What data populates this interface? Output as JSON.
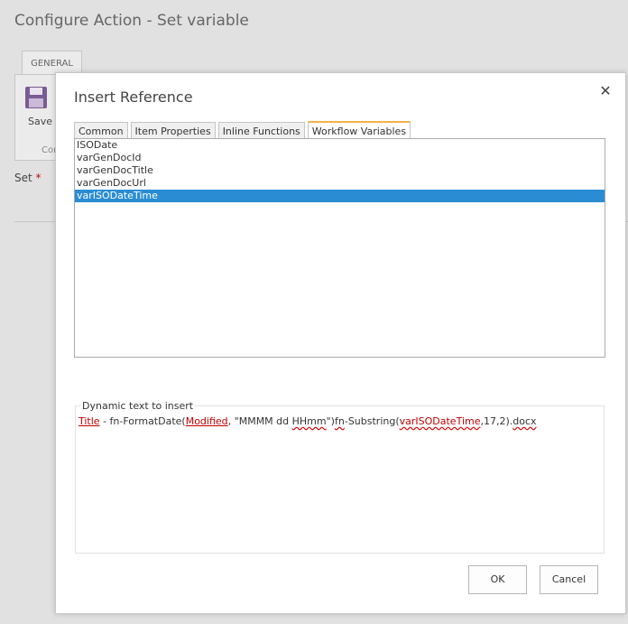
{
  "page": {
    "title": "Configure Action - Set variable"
  },
  "ribbon": {
    "tab": "GENERAL",
    "save_label": "Save",
    "group_label": "Con"
  },
  "form": {
    "set_label": "Set",
    "required_mark": "*"
  },
  "dialog": {
    "title": "Insert Reference",
    "close_glyph": "✕",
    "tabs": [
      {
        "label": "Common",
        "active": false
      },
      {
        "label": "Item Properties",
        "active": false
      },
      {
        "label": "Inline Functions",
        "active": false
      },
      {
        "label": "Workflow Variables",
        "active": true
      }
    ],
    "list_items": [
      {
        "label": "ISODate",
        "selected": false
      },
      {
        "label": "varGenDocId",
        "selected": false
      },
      {
        "label": "varGenDocTitle",
        "selected": false
      },
      {
        "label": "varGenDocUrl",
        "selected": false
      },
      {
        "label": "varISODateTime",
        "selected": true
      }
    ],
    "dynamic_text": {
      "legend": "Dynamic text to insert",
      "ref_title": "Title",
      "t1": " - fn-FormatDate(",
      "ref_modified": "Modified",
      "t2": ", \"MMMM dd ",
      "sq_hhmm": "HHmm",
      "t3": "\")",
      "sq_fn": "fn",
      "t4": "-Substring(",
      "ref_var": "varISODateTime",
      "t5": ",17,2).",
      "sq_docx": "docx"
    },
    "ok_label": "OK",
    "cancel_label": "Cancel"
  },
  "colors": {
    "selection": "#2a8dd4",
    "active_tab_accent": "#f6b24a",
    "reference_token": "#c00000"
  }
}
